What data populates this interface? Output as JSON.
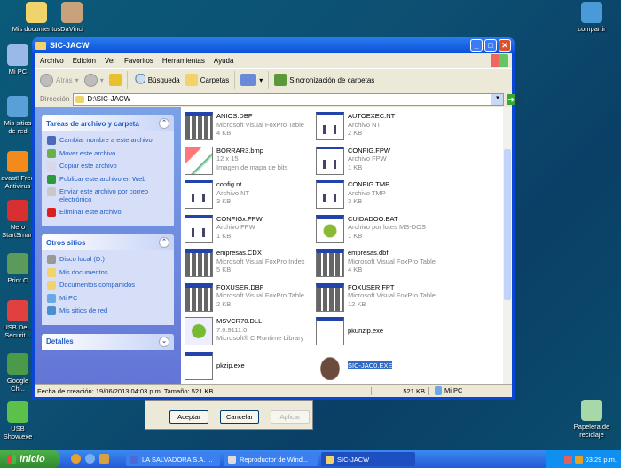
{
  "desktop": {
    "icons": [
      {
        "label": "Mis documentos",
        "color": "#f1d36c"
      },
      {
        "label": "DaVinci",
        "color": "#c9a17a"
      },
      {
        "label": "Mi PC",
        "color": "#9ab8e8"
      },
      {
        "label": "Mis sitios de red",
        "color": "#5aa0d8"
      },
      {
        "label": "avast! Free Antivirus",
        "color": "#f28a1e"
      },
      {
        "label": "Nero StartSmart",
        "color": "#d83030"
      },
      {
        "label": "Print C",
        "color": "#5a9a5a"
      },
      {
        "label": "USB De... Securit...",
        "color": "#e04040"
      },
      {
        "label": "Google Ch...",
        "color": "#4a9a4a"
      },
      {
        "label": "USB Show.exe",
        "color": "#5bc14a"
      },
      {
        "label": "compartir",
        "color": "#4a9ad8"
      },
      {
        "label": "Papelera de reciclaje",
        "color": "#a8d8a8"
      }
    ]
  },
  "window": {
    "title": "SIC-JACW",
    "menu": [
      "Archivo",
      "Edición",
      "Ver",
      "Favoritos",
      "Herramientas",
      "Ayuda"
    ],
    "toolbar": {
      "back": "Atrás",
      "search": "Búsqueda",
      "folders": "Carpetas",
      "sync": "Sincronización de carpetas"
    },
    "address": {
      "label": "Dirección",
      "value": "D:\\SIC-JACW",
      "go": "Ir"
    },
    "tasks": {
      "title": "Tareas de archivo y carpeta",
      "items": [
        {
          "label": "Cambiar nombre a este archivo",
          "icon": "rename-icon",
          "color": "#4a6ab8"
        },
        {
          "label": "Mover este archivo",
          "icon": "move-icon",
          "color": "#6ab04a"
        },
        {
          "label": "Copiar este archivo",
          "icon": "copy-icon",
          "color": "#d8d8e8"
        },
        {
          "label": "Publicar este archivo en Web",
          "icon": "web-icon",
          "color": "#2a9a3a"
        },
        {
          "label": "Enviar este archivo por correo electrónico",
          "icon": "email-icon",
          "color": "#c8c8c8"
        },
        {
          "label": "Eliminar este archivo",
          "icon": "delete-icon",
          "color": "#d82020"
        }
      ]
    },
    "places": {
      "title": "Otros sitios",
      "items": [
        {
          "label": "Disco local (D:)",
          "icon": "disk-icon",
          "color": "#999"
        },
        {
          "label": "Mis documentos",
          "icon": "folder-icon",
          "color": "#f1d36c"
        },
        {
          "label": "Documentos compartidos",
          "icon": "folder-icon",
          "color": "#f1d36c"
        },
        {
          "label": "Mi PC",
          "icon": "computer-icon",
          "color": "#6aa8e8"
        },
        {
          "label": "Mis sitios de red",
          "icon": "network-icon",
          "color": "#4a90d0"
        }
      ]
    },
    "details": {
      "title": "Detalles"
    },
    "files": [
      {
        "name": "ANIOS.DBF",
        "l1": "Microsoft Visual FoxPro Table",
        "l2": "4 KB",
        "type": "tbl"
      },
      {
        "name": "AUTOEXEC.NT",
        "l1": "Archivo NT",
        "l2": "2 KB",
        "type": "doc"
      },
      {
        "name": "BORRAR3.bmp",
        "l1": "12 x 15",
        "l2": "Imagen de mapa de bits",
        "type": "bmp"
      },
      {
        "name": "CONFIG.FPW",
        "l1": "Archivo FPW",
        "l2": "1 KB",
        "type": "doc"
      },
      {
        "name": "config.nt",
        "l1": "Archivo NT",
        "l2": "3 KB",
        "type": "doc"
      },
      {
        "name": "CONFIG.TMP",
        "l1": "Archivo TMP",
        "l2": "3 KB",
        "type": "doc"
      },
      {
        "name": "CONFIGx.FPW",
        "l1": "Archivo FPW",
        "l2": "1 KB",
        "type": "doc"
      },
      {
        "name": "CUIDADOO.BAT",
        "l1": "Archivo por lotes MS-DOS",
        "l2": "1 KB",
        "type": "gear"
      },
      {
        "name": "empresas.CDX",
        "l1": "Microsoft Visual FoxPro Index",
        "l2": "5 KB",
        "type": "tbl"
      },
      {
        "name": "empresas.dbf",
        "l1": "Microsoft Visual FoxPro Table",
        "l2": "4 KB",
        "type": "tbl"
      },
      {
        "name": "FOXUSER.DBF",
        "l1": "Microsoft Visual FoxPro Table",
        "l2": "2 KB",
        "type": "tbl"
      },
      {
        "name": "FOXUSER.FPT",
        "l1": "Microsoft Visual FoxPro Table",
        "l2": "12 KB",
        "type": "tbl"
      },
      {
        "name": "MSVCR70.DLL",
        "l1": "7.0.9111.0",
        "l2": "Microsoft® C Runtime Library",
        "type": "dll"
      },
      {
        "name": "pkunzip.exe",
        "l1": "",
        "l2": "",
        "type": "exe"
      },
      {
        "name": "pkzip.exe",
        "l1": "",
        "l2": "",
        "type": "exe"
      },
      {
        "name": "SIC-JAC0.EXE",
        "l1": "",
        "l2": "",
        "type": "fox",
        "selected": true
      }
    ],
    "status": {
      "info": "Fecha de creación: 19/06/2013 04:03 p.m. Tamaño: 521 KB",
      "size": "521 KB",
      "zone": "Mi PC"
    }
  },
  "dialog": {
    "ok": "Aceptar",
    "cancel": "Cancelar",
    "apply": "Aplicar"
  },
  "taskbar": {
    "start": "Inicio",
    "tasks": [
      "LA SALVADORA S.A. ...",
      "Reproductor de Wind...",
      "SIC-JACW"
    ],
    "clock": "03:29 p.m."
  }
}
